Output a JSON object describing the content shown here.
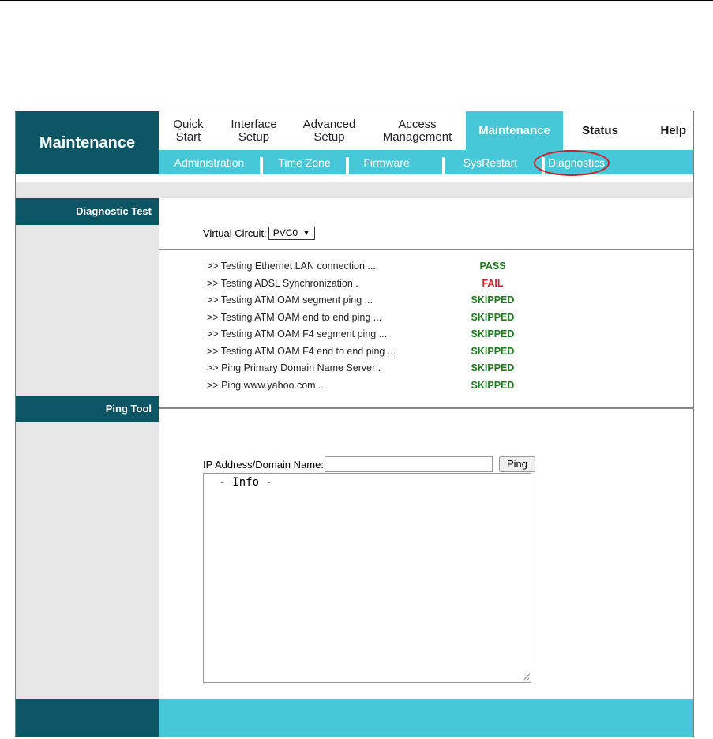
{
  "header": {
    "brand": "Maintenance",
    "tabs": [
      {
        "label": "Quick\nStart"
      },
      {
        "label": "Interface\nSetup"
      },
      {
        "label": "Advanced\nSetup"
      },
      {
        "label": "Access\nManagement"
      },
      {
        "label": "Maintenance",
        "active": true
      },
      {
        "label": "Status"
      },
      {
        "label": "Help"
      }
    ],
    "subtabs": [
      {
        "label": "Administration"
      },
      {
        "label": "Time Zone"
      },
      {
        "label": "Firmware"
      },
      {
        "label": "SysRestart"
      },
      {
        "label": "Diagnostics",
        "active": true
      }
    ]
  },
  "diagnostic": {
    "section_label": "Diagnostic Test",
    "vc_label": "Virtual Circuit:",
    "vc_value": "PVC0",
    "tests": [
      {
        "label": ">> Testing Ethernet LAN connection ...",
        "result": "PASS"
      },
      {
        "label": ">> Testing ADSL Synchronization .",
        "result": "FAIL"
      },
      {
        "label": ">> Testing ATM OAM segment ping ...",
        "result": "SKIPPED"
      },
      {
        "label": ">> Testing ATM OAM end to end ping ...",
        "result": "SKIPPED"
      },
      {
        "label": ">> Testing ATM OAM F4 segment ping ...",
        "result": "SKIPPED"
      },
      {
        "label": ">> Testing ATM OAM F4 end to end ping ...",
        "result": "SKIPPED"
      },
      {
        "label": ">> Ping Primary Domain Name Server .",
        "result": "SKIPPED"
      },
      {
        "label": ">> Ping www.yahoo.com ...",
        "result": "SKIPPED"
      }
    ]
  },
  "ping": {
    "section_label": "Ping Tool",
    "ip_label": "IP Address/Domain Name:",
    "ip_value": "",
    "button_label": "Ping",
    "info_text": " - Info -"
  },
  "colors": {
    "dark_teal": "#0b5565",
    "light_teal": "#47c8d8",
    "pass": "#1d7a1d",
    "fail": "#d12020",
    "highlight": "#d11f2a"
  }
}
